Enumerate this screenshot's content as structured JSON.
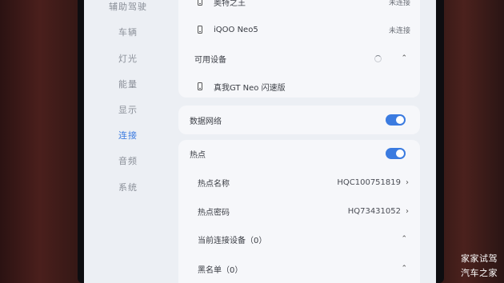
{
  "sidebar": {
    "items": [
      {
        "label": "辅助驾驶",
        "active": false
      },
      {
        "label": "车辆",
        "active": false
      },
      {
        "label": "灯光",
        "active": false
      },
      {
        "label": "能量",
        "active": false
      },
      {
        "label": "显示",
        "active": false
      },
      {
        "label": "连接",
        "active": true
      },
      {
        "label": "音频",
        "active": false
      },
      {
        "label": "系统",
        "active": false
      }
    ]
  },
  "bluetooth": {
    "paired": [
      {
        "name": "奥特之王",
        "status": "未连接"
      },
      {
        "name": "iQOO Neo5",
        "status": "未连接"
      }
    ],
    "available_label": "可用设备",
    "available": [
      {
        "name": "真我GT Neo 闪速版"
      }
    ]
  },
  "mobile_data": {
    "label": "数据网络",
    "enabled": true
  },
  "hotspot": {
    "label": "热点",
    "enabled": true,
    "name_label": "热点名称",
    "name_value": "HQC100751819",
    "password_label": "热点密码",
    "password_value": "HQ73431052",
    "connected_label": "当前连接设备（0）",
    "blacklist_label": "黑名单（0）"
  },
  "watermark": {
    "line1": "家家试驾",
    "line2": "汽车之家"
  },
  "icons": {
    "phone": "phone-icon",
    "chevron_right": "chevron-right-icon",
    "caret_up": "caret-up-icon",
    "spinner": "loading-spinner-icon"
  },
  "colors": {
    "accent": "#3b7be0",
    "screen_bg": "#eceff4",
    "card_bg": "#f6f7fa"
  }
}
